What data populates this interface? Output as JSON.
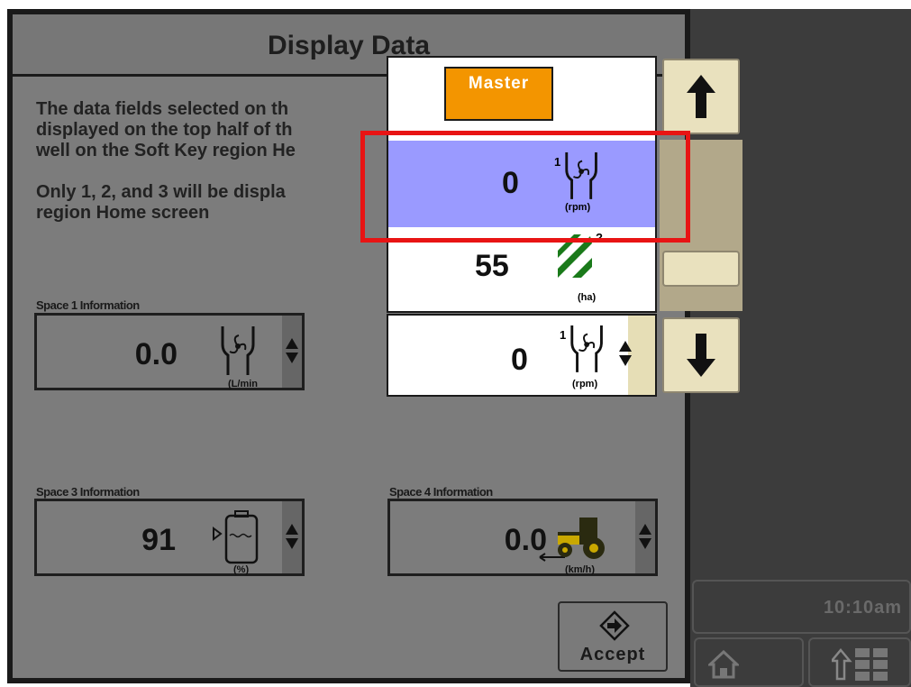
{
  "header": {
    "title": "Display Data"
  },
  "description": {
    "line1": "The data fields selected on th",
    "line2": "displayed on the top half of th",
    "line3": "well on the Soft Key region He",
    "line4": "Only 1, 2, and 3 will be displa",
    "line5": "region Home screen"
  },
  "spaces": {
    "space1": {
      "label": "Space 1 Information",
      "value": "0.0",
      "unit": "(L/min",
      "icon": "fan-flow-icon"
    },
    "space3": {
      "label": "Space 3 Information",
      "value": "91",
      "unit": "(%)",
      "icon": "tank-level-icon"
    },
    "space4": {
      "label": "Space 4 Information",
      "value": "0.0",
      "unit": "(km/h)",
      "icon": "tractor-speed-icon"
    }
  },
  "dropdown": {
    "master_label": "Master",
    "options": [
      {
        "value": "0",
        "superscript": "1",
        "unit": "(rpm)",
        "icon": "fan-rpm-icon",
        "selected": true
      },
      {
        "value": "55",
        "superscript": "?",
        "unit": "(ha)",
        "icon": "area-stripes-icon",
        "selected": false
      }
    ],
    "current": {
      "value": "0",
      "superscript": "1",
      "unit": "(rpm)",
      "icon": "fan-rpm-icon"
    }
  },
  "footer": {
    "accept_label": "Accept",
    "clock": "10:10am"
  },
  "colors": {
    "master": "#f39500",
    "selected_row": "#9a9aff",
    "highlight": "#e81414",
    "area_icon": "#1a7a1a"
  }
}
